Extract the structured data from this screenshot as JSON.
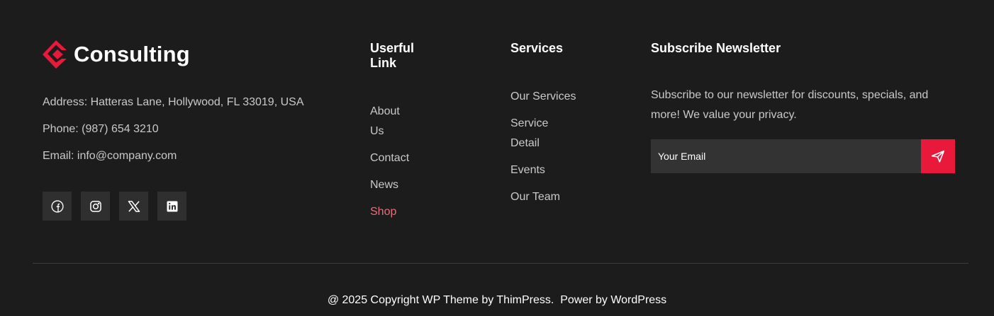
{
  "brand": {
    "name": "Consulting",
    "accent_color": "#e8193a"
  },
  "contact": {
    "address": "Address: Hatteras Lane, Hollywood, FL 33019, USA",
    "phone": "Phone: (987) 654 3210",
    "email": "Email: info@company.com"
  },
  "socials": [
    {
      "icon": "facebook-icon"
    },
    {
      "icon": "instagram-icon"
    },
    {
      "icon": "x-icon"
    },
    {
      "icon": "linkedin-icon"
    }
  ],
  "useful_links": {
    "title": "Userful Link",
    "items": [
      {
        "label": "About Us"
      },
      {
        "label": "Contact"
      },
      {
        "label": "News"
      },
      {
        "label": "Shop",
        "active": true,
        "color": "#e86d7c"
      }
    ]
  },
  "services": {
    "title": "Services",
    "items": [
      {
        "label": "Our Services"
      },
      {
        "label": "Service Detail"
      },
      {
        "label": "Events"
      },
      {
        "label": "Our Team"
      }
    ]
  },
  "newsletter": {
    "title": "Subscribe Newsletter",
    "description": "Subscribe to our newsletter for discounts, specials, and more! We value your privacy.",
    "placeholder": "Your Email",
    "send_icon": "send-icon"
  },
  "footer_bottom": {
    "copyright": "@ 2025 Copyright WP Theme by ThimPress.",
    "powered": "Power by WordPress"
  }
}
